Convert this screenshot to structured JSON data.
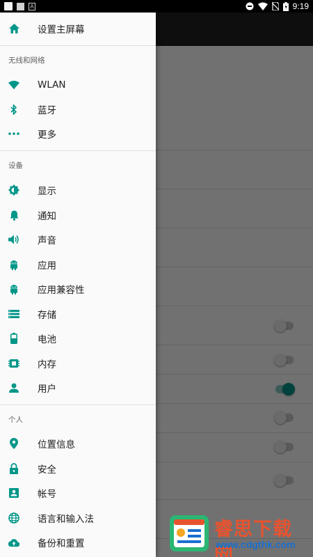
{
  "status_bar": {
    "time": "9:19",
    "left_icons": [
      "app-notification-icon",
      "image-icon",
      "a-icon"
    ],
    "right_icons": [
      "do-not-disturb-icon",
      "wifi-icon",
      "no-sim-icon",
      "battery-icon"
    ],
    "a_glyph": "A"
  },
  "drawer": {
    "home": {
      "label": "设置主屏幕",
      "icon": "home-icon"
    },
    "sections": [
      {
        "title": "无线和网络",
        "items": [
          {
            "label": "WLAN",
            "icon": "wifi-icon"
          },
          {
            "label": "蓝牙",
            "icon": "bluetooth-icon"
          },
          {
            "label": "更多",
            "icon": "more-dots-icon"
          }
        ]
      },
      {
        "title": "设备",
        "items": [
          {
            "label": "显示",
            "icon": "brightness-icon"
          },
          {
            "label": "通知",
            "icon": "bell-icon"
          },
          {
            "label": "声音",
            "icon": "volume-icon"
          },
          {
            "label": "应用",
            "icon": "android-icon"
          },
          {
            "label": "应用兼容性",
            "icon": "android-icon"
          },
          {
            "label": "存储",
            "icon": "storage-icon"
          },
          {
            "label": "电池",
            "icon": "battery-icon"
          },
          {
            "label": "内存",
            "icon": "memory-icon"
          },
          {
            "label": "用户",
            "icon": "person-icon"
          }
        ]
      },
      {
        "title": "个人",
        "items": [
          {
            "label": "位置信息",
            "icon": "location-pin-icon"
          },
          {
            "label": "安全",
            "icon": "lock-icon"
          },
          {
            "label": "帐号",
            "icon": "account-box-icon"
          },
          {
            "label": "语言和输入法",
            "icon": "globe-icon"
          },
          {
            "label": "备份和重置",
            "icon": "cloud-upload-icon"
          }
        ]
      }
    ]
  },
  "background": {
    "switches": [
      false,
      false,
      true,
      false,
      false,
      false
    ]
  },
  "watermark": {
    "title": "睿思下载网",
    "url": "www.cdgthk.com"
  },
  "colors": {
    "accent": "#009688",
    "toolbar": "#212121",
    "status_bar": "#000000",
    "watermark_title": "#e8532f",
    "watermark_url": "#1a6fd1"
  }
}
